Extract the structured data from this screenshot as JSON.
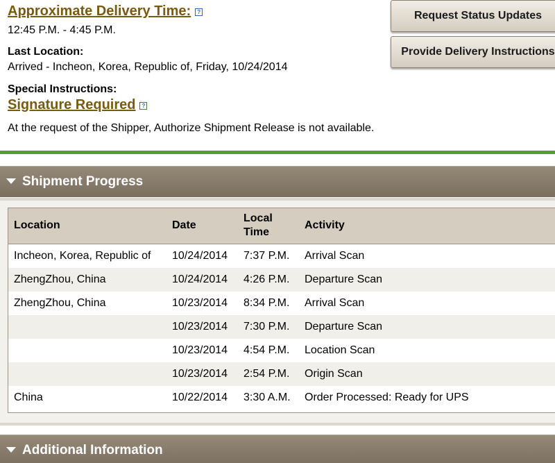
{
  "delivery": {
    "approx_label": "Approximate Delivery Time:",
    "approx_value": "12:45 P.M. - 4:45 P.M.",
    "last_location_label": "Last Location:",
    "last_location_value": "Arrived - Incheon, Korea, Republic of, Friday, 10/24/2014",
    "special_instructions_label": "Special Instructions:",
    "signature_label": "Signature Required",
    "release_note": "At the request of the Shipper, Authorize Shipment Release is not available.",
    "help_glyph": "?"
  },
  "buttons": {
    "request_status": "Request Status Updates",
    "delivery_instructions": "Provide Delivery Instructions"
  },
  "sections": {
    "shipment_progress": "Shipment Progress",
    "additional_information": "Additional Information"
  },
  "table": {
    "headers": {
      "location": "Location",
      "date": "Date",
      "local_time_line1": "Local",
      "local_time_line2": "Time",
      "activity": "Activity"
    },
    "rows": [
      {
        "location": "Incheon, Korea, Republic of",
        "date": "10/24/2014",
        "time": "7:37 P.M.",
        "activity": "Arrival Scan"
      },
      {
        "location": "ZhengZhou, China",
        "date": "10/24/2014",
        "time": "4:26 P.M.",
        "activity": "Departure Scan"
      },
      {
        "location": "ZhengZhou, China",
        "date": "10/23/2014",
        "time": "8:34 P.M.",
        "activity": "Arrival Scan"
      },
      {
        "location": "",
        "date": "10/23/2014",
        "time": "7:30 P.M.",
        "activity": "Departure Scan"
      },
      {
        "location": "",
        "date": "10/23/2014",
        "time": "4:54 P.M.",
        "activity": "Location Scan"
      },
      {
        "location": "",
        "date": "10/23/2014",
        "time": "2:54 P.M.",
        "activity": "Origin Scan"
      },
      {
        "location": "China",
        "date": "10/22/2014",
        "time": "3:30 A.M.",
        "activity": "Order Processed: Ready for UPS"
      }
    ]
  },
  "icons": {
    "help": "help-icon",
    "collapse": "triangle-down-icon"
  },
  "colors": {
    "link": "#7a5a10",
    "green_rule": "#5a9a2f",
    "section_header": "#7a6f60",
    "table_header": "#d5cdbf"
  }
}
